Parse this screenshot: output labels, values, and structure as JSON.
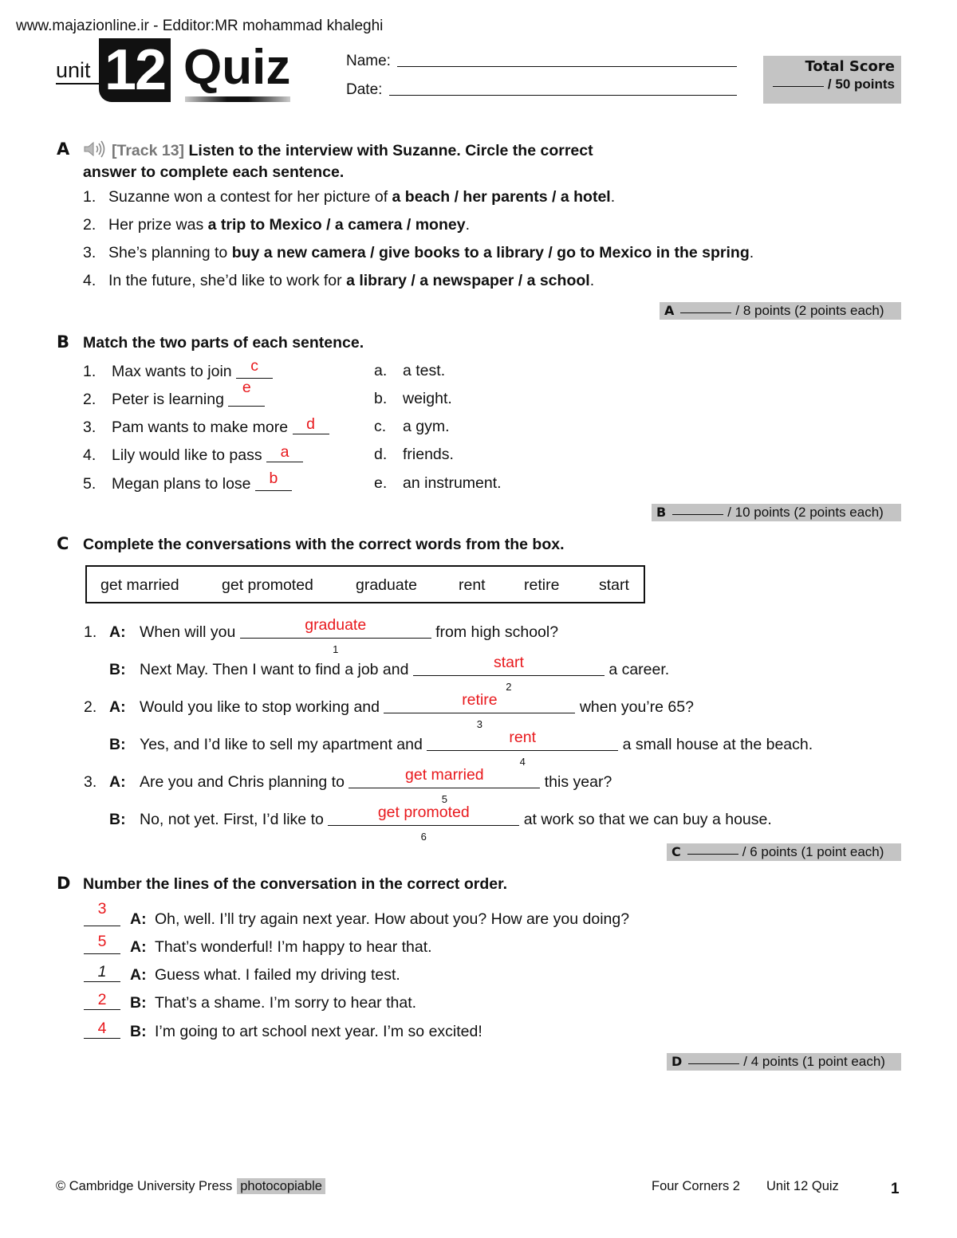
{
  "header": {
    "watermark": "www.majazionline.ir - Edditor:MR mohammad khaleghi",
    "unit_word": "unit",
    "unit_number": "12",
    "quiz_word": "Quiz",
    "name_label": "Name:",
    "date_label": "Date:",
    "name_value": "",
    "date_value": "",
    "total_score_title": "Total Score",
    "total_score_points": "/ 50 points"
  },
  "section_a": {
    "letter": "A",
    "track": "[Track 13]",
    "instruction_line1": "Listen to the interview with Suzanne. Circle the correct",
    "instruction_line2": "answer to complete each sentence.",
    "items": [
      {
        "num": "1.",
        "text": "Suzanne won a contest for her picture of ",
        "options": "a beach / her parents / a hotel",
        "end": "."
      },
      {
        "num": "2.",
        "text": "Her prize was ",
        "options": "a trip to Mexico / a camera / money",
        "end": "."
      },
      {
        "num": "3.",
        "text": "She’s planning to ",
        "options": "buy a new camera / give books to a library / go to Mexico in the spring",
        "end": "."
      },
      {
        "num": "4.",
        "text": "In the future, she’d like to work for ",
        "options": "a library / a newspaper / a school",
        "end": "."
      }
    ],
    "score": {
      "letter": "A",
      "text": "/ 8 points (2 points each)"
    }
  },
  "section_b": {
    "letter": "B",
    "instruction": "Match the two parts of each sentence.",
    "left": [
      {
        "num": "1.",
        "text": "Max wants to join",
        "answer": "c"
      },
      {
        "num": "2.",
        "text": "Peter is learning",
        "answer": "e"
      },
      {
        "num": "3.",
        "text": "Pam wants to make more",
        "answer": "d"
      },
      {
        "num": "4.",
        "text": "Lily would like to pass",
        "answer": "a"
      },
      {
        "num": "5.",
        "text": "Megan plans to lose",
        "answer": "b"
      }
    ],
    "right": [
      {
        "letter": "a.",
        "text": "a test."
      },
      {
        "letter": "b.",
        "text": "weight."
      },
      {
        "letter": "c.",
        "text": "a gym."
      },
      {
        "letter": "d.",
        "text": "friends."
      },
      {
        "letter": "e.",
        "text": "an instrument."
      }
    ],
    "score": {
      "letter": "B",
      "text": "/ 10 points (2 points each)"
    }
  },
  "section_c": {
    "letter": "C",
    "instruction": "Complete the conversations with the correct words from the box.",
    "word_box": [
      "get married",
      "get promoted",
      "graduate",
      "rent",
      "retire",
      "start"
    ],
    "lines": [
      {
        "num": "1.",
        "speaker": "A:",
        "before": "When will you",
        "answer": "graduate",
        "index": "1",
        "after": "from high school?"
      },
      {
        "num": "",
        "speaker": "B:",
        "before": "Next May. Then I want to find a job and",
        "answer": "start",
        "index": "2",
        "after": "a career."
      },
      {
        "num": "2.",
        "speaker": "A:",
        "before": "Would you like to stop working and",
        "answer": "retire",
        "index": "3",
        "after": "when you’re 65?"
      },
      {
        "num": "",
        "speaker": "B:",
        "before": "Yes, and I’d like to sell my apartment and",
        "answer": "rent",
        "index": "4",
        "after": "a small house at the beach."
      },
      {
        "num": "3.",
        "speaker": "A:",
        "before": "Are you and Chris planning to",
        "answer": "get married",
        "index": "5",
        "after": "this year?"
      },
      {
        "num": "",
        "speaker": "B:",
        "before": "No, not yet. First, I’d like to",
        "answer": "get promoted",
        "index": "6",
        "after": "at work so that we can buy a house."
      }
    ],
    "score": {
      "letter": "C",
      "text": "/ 6 points (1 point each)"
    }
  },
  "section_d": {
    "letter": "D",
    "instruction": "Number the lines of the conversation in the correct order.",
    "lines": [
      {
        "answer": "3",
        "speaker": "A:",
        "text": "Oh, well. I’ll try again next year. How about you? How are you doing?"
      },
      {
        "answer": "5",
        "speaker": "A:",
        "text": "That’s wonderful! I’m happy to hear that."
      },
      {
        "answer": "1",
        "speaker": "A:",
        "text": "Guess what. I failed my driving test.",
        "printed": true
      },
      {
        "answer": "2",
        "speaker": "B:",
        "text": "That’s a shame. I’m sorry to hear that."
      },
      {
        "answer": "4",
        "speaker": "B:",
        "text": "I’m going to art school next year. I’m so excited!"
      }
    ],
    "score": {
      "letter": "D",
      "text": "/ 4 points (1 point each)"
    }
  },
  "footer": {
    "copyright": "© Cambridge University Press",
    "photocopiable": "photocopiable",
    "book": "Four Corners 2",
    "quiz": "Unit 12 Quiz",
    "page": "1"
  }
}
